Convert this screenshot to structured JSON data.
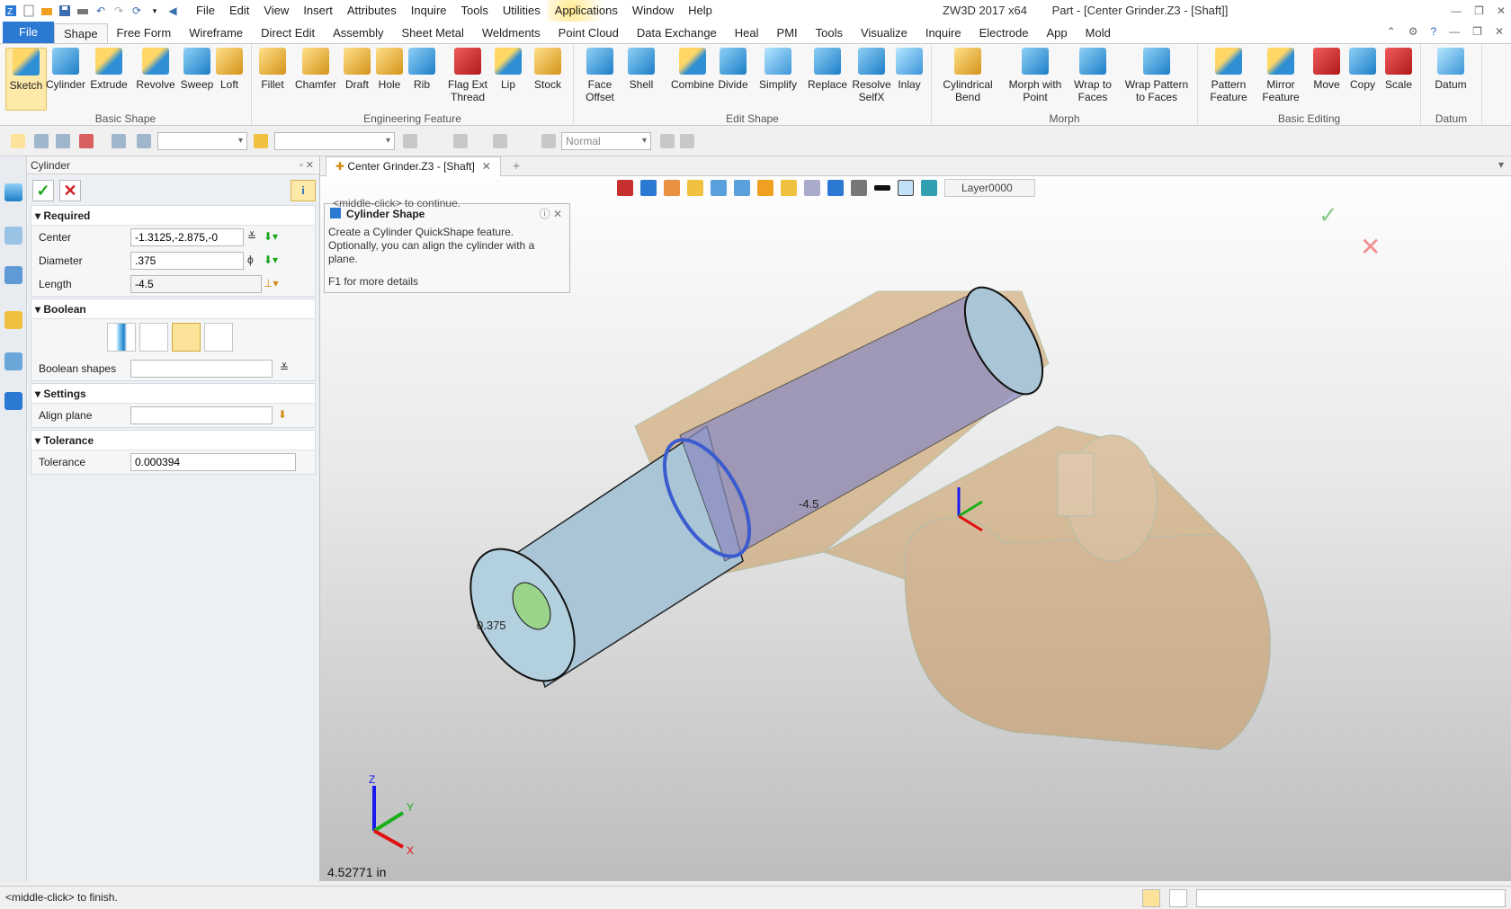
{
  "menu": [
    "File",
    "Edit",
    "View",
    "Insert",
    "Attributes",
    "Inquire",
    "Tools",
    "Utilities",
    "Applications",
    "Window",
    "Help"
  ],
  "title": {
    "app": "ZW3D 2017  x64",
    "doc": "Part - [Center Grinder.Z3 - [Shaft]]"
  },
  "tabs": [
    "File",
    "Shape",
    "Free Form",
    "Wireframe",
    "Direct Edit",
    "Assembly",
    "Sheet Metal",
    "Weldments",
    "Point Cloud",
    "Data Exchange",
    "Heal",
    "PMI",
    "Tools",
    "Visualize",
    "Inquire",
    "Electrode",
    "App",
    "Mold"
  ],
  "ribbon": {
    "basic_shape": {
      "label": "Basic Shape",
      "items": [
        "Sketch",
        "Cylinder",
        "Extrude",
        "Revolve",
        "Sweep",
        "Loft"
      ]
    },
    "engineering": {
      "label": "Engineering Feature",
      "items": [
        "Fillet",
        "Chamfer",
        "Draft",
        "Hole",
        "Rib",
        "Flag Ext\nThread",
        "Lip",
        "Stock"
      ]
    },
    "edit_shape": {
      "label": "Edit Shape",
      "items": [
        "Face\nOffset",
        "Shell",
        "Combine",
        "Divide",
        "Simplify",
        "Replace",
        "Resolve\nSelfX",
        "Inlay"
      ]
    },
    "morph": {
      "label": "Morph",
      "items": [
        "Cylindrical\nBend",
        "Morph with\nPoint",
        "Wrap to\nFaces",
        "Wrap Pattern\nto Faces"
      ]
    },
    "basic_editing": {
      "label": "Basic Editing",
      "items": [
        "Pattern\nFeature",
        "Mirror\nFeature",
        "Move",
        "Copy",
        "Scale"
      ]
    },
    "datum": {
      "label": "Datum",
      "items": [
        "Datum"
      ]
    }
  },
  "toolbar2": {
    "render_mode": "Normal"
  },
  "panel": {
    "title": "Cylinder",
    "required": {
      "label": "Required",
      "center_label": "Center",
      "center": "-1.3125,-2.875,-0",
      "diameter_label": "Diameter",
      "diameter": ".375",
      "length_label": "Length",
      "length": "-4.5"
    },
    "boolean": {
      "label": "Boolean",
      "shapes_label": "Boolean shapes"
    },
    "settings": {
      "label": "Settings",
      "align_label": "Align plane"
    },
    "tolerance": {
      "label": "Tolerance",
      "tol_label": "Tolerance",
      "tol": "0.000394"
    }
  },
  "viewport": {
    "doc_tab": "Center Grinder.Z3 - [Shaft]",
    "layer": "Layer0000",
    "hint_ghost": "<middle-click> to continue.",
    "tip_title": "Cylinder Shape",
    "tip_body": "Create a Cylinder QuickShape feature.  Optionally, you can align the cylinder with a plane.",
    "tip_f1": "F1 for more details",
    "dim_length": "-4.5",
    "dim_diameter": "0.375",
    "readout": "4.52771 in",
    "axis": {
      "x": "X",
      "y": "Y",
      "z": "Z"
    }
  },
  "status": "<middle-click> to finish."
}
